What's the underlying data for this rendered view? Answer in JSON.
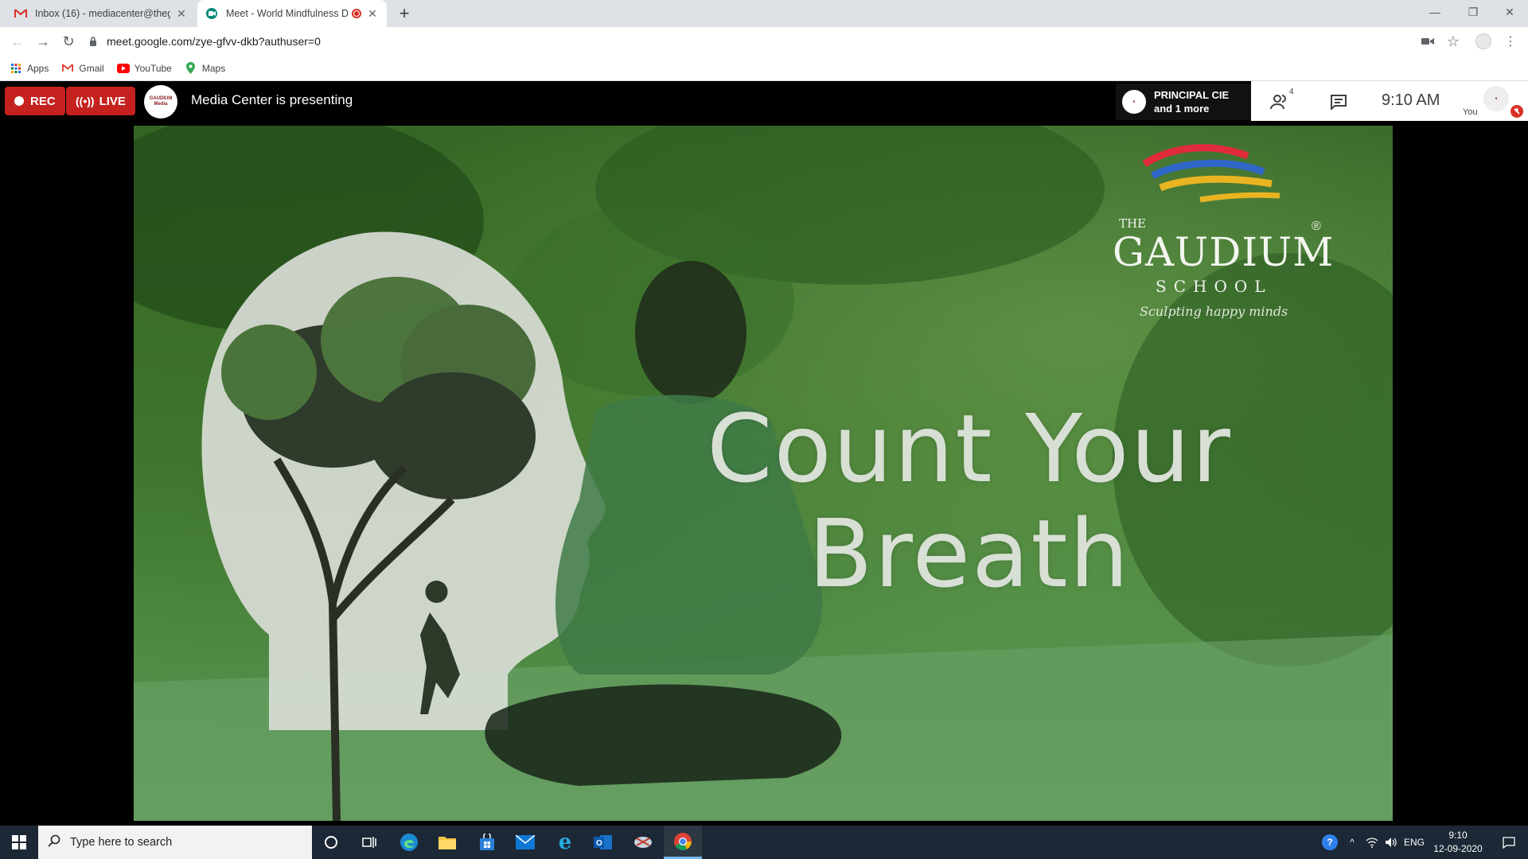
{
  "browser": {
    "tabs": [
      {
        "title": "Inbox (16) - mediacenter@thegaudium",
        "favicon": "gmail-icon",
        "active": false
      },
      {
        "title": "Meet - World Mindfulness D",
        "favicon": "meet-icon",
        "active": true,
        "recording": true
      }
    ],
    "url": "meet.google.com/zye-gfvv-dkb?authuser=0",
    "bookmarks": [
      {
        "label": "Apps",
        "icon": "apps-grid-icon"
      },
      {
        "label": "Gmail",
        "icon": "gmail-icon"
      },
      {
        "label": "YouTube",
        "icon": "youtube-icon"
      },
      {
        "label": "Maps",
        "icon": "maps-pin-icon"
      }
    ]
  },
  "meet": {
    "rec_label": "REC",
    "live_label": "LIVE",
    "presenter_avatar_text": "GAUDIUM Media",
    "presenting_text": "Media Center is presenting",
    "speaker_line1": "PRINCIPAL CIE",
    "speaker_line2": "and 1 more",
    "participant_count": "4",
    "clock": "9:10 AM",
    "you_label": "You"
  },
  "presentation": {
    "headline_line1": "Count Your",
    "headline_line2": "Breath",
    "logo_the": "THE",
    "logo_name": "GAUDIUM",
    "logo_school": "SCHOOL",
    "logo_tagline": "Sculpting happy minds",
    "logo_reg": "®"
  },
  "taskbar": {
    "search_placeholder": "Type here to search",
    "language": "ENG",
    "time": "9:10",
    "date": "12-09-2020"
  },
  "colors": {
    "rec_red": "#c5221f",
    "meet_bar": "#000000",
    "taskbar": "#1c2836",
    "slide_green": "#3f7a2f"
  }
}
